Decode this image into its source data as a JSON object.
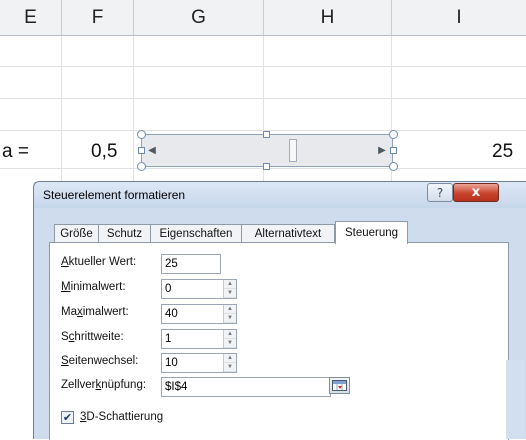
{
  "sheet": {
    "columns": [
      "E",
      "F",
      "G",
      "H",
      "I"
    ],
    "cells": {
      "label": "a =",
      "value": "0,5",
      "result": "25"
    }
  },
  "dialog": {
    "title": "Steuerelement formatieren",
    "help_label": "?",
    "close_label": "x",
    "tabs": [
      "Größe",
      "Schutz",
      "Eigenschaften",
      "Alternativtext",
      "Steuerung"
    ],
    "active_tab": "Steuerung",
    "fields": {
      "current": {
        "label_pre": "",
        "label_u": "A",
        "label_post": "ktueller Wert:",
        "value": "25"
      },
      "min": {
        "label_pre": "",
        "label_u": "M",
        "label_post": "inimalwert:",
        "value": "0"
      },
      "max": {
        "label_pre": "Ma",
        "label_u": "x",
        "label_post": "imalwert:",
        "value": "40"
      },
      "step": {
        "label_pre": "S",
        "label_u": "c",
        "label_post": "hrittweite:",
        "value": "1"
      },
      "page": {
        "label_pre": "",
        "label_u": "S",
        "label_post": "eitenwechsel:",
        "value": "10"
      },
      "link": {
        "label_pre": "Zellver",
        "label_u": "k",
        "label_post": "nüpfung:",
        "value": "$I$4"
      }
    },
    "shading": {
      "label_pre": "",
      "label_u": "3",
      "label_post": "D-Schattierung",
      "checked": true
    }
  },
  "scrollbar": {
    "value": 25,
    "min": 0,
    "max": 40
  },
  "colors": {
    "title_bar": "#c6d6ea",
    "close_button": "#c9442c",
    "grid": "#dfe1e5"
  }
}
